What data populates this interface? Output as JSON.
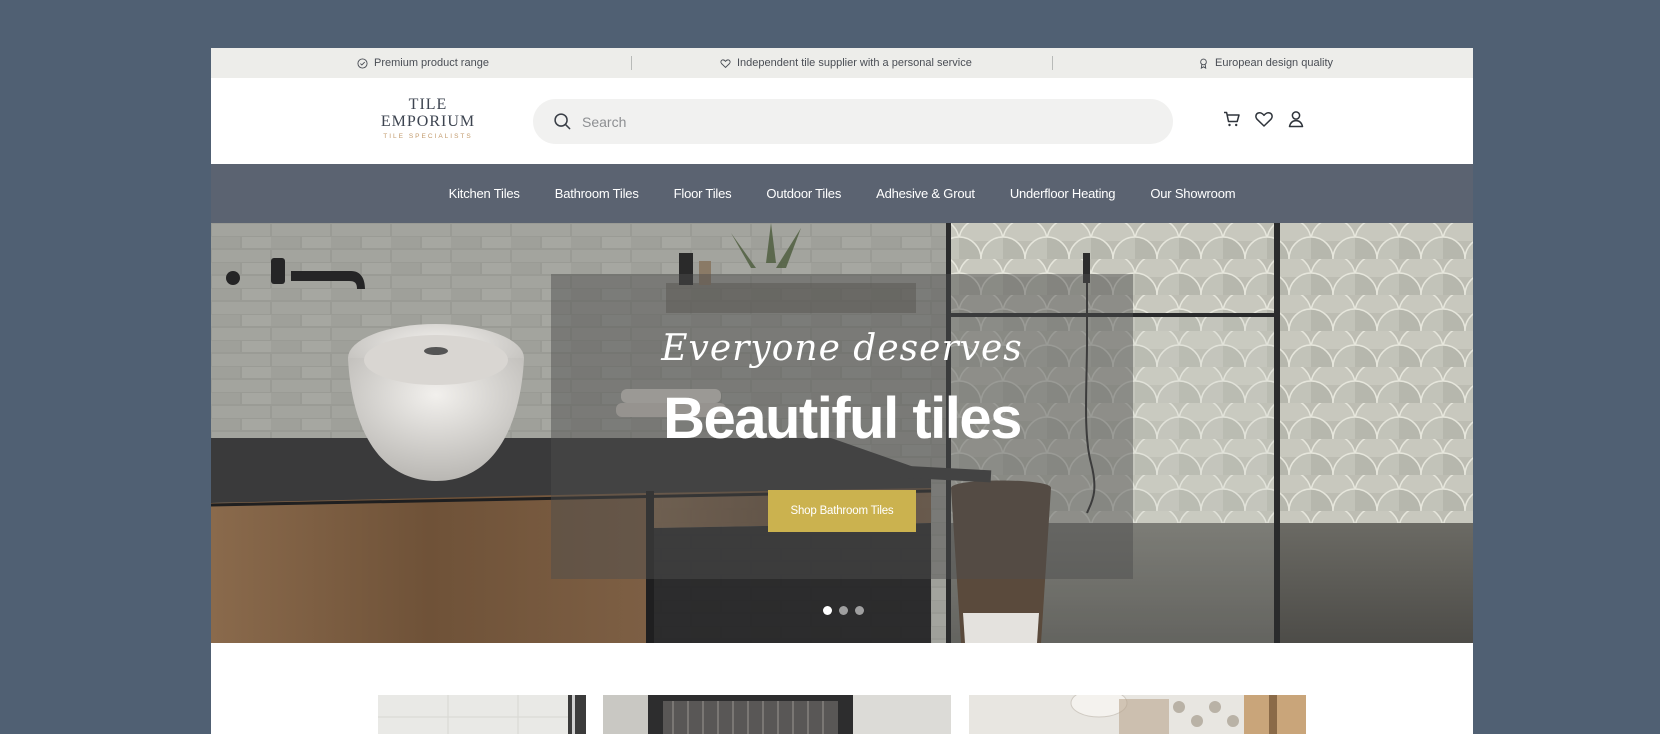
{
  "topbar": {
    "usps": [
      {
        "icon": "check-circle-icon",
        "text": "Premium product range"
      },
      {
        "icon": "heart-icon",
        "text": "Independent tile supplier with a personal service"
      },
      {
        "icon": "award-ribbon-icon",
        "text": "European design quality"
      }
    ]
  },
  "header": {
    "logo": {
      "line1": "TILE",
      "line2": "EMPORIUM",
      "tagline": "TILE SPECIALISTS"
    },
    "search": {
      "placeholder": "Search",
      "value": ""
    },
    "icons": [
      "cart-icon",
      "heart-icon",
      "user-icon"
    ]
  },
  "nav": {
    "items": [
      "Kitchen Tiles",
      "Bathroom Tiles",
      "Floor Tiles",
      "Outdoor Tiles",
      "Adhesive & Grout",
      "Underfloor Heating",
      "Our Showroom"
    ]
  },
  "hero": {
    "script_text": "Everyone deserves",
    "title": "Beautiful tiles",
    "button_label": "Shop Bathroom Tiles",
    "slides": 3,
    "active_slide": 1
  },
  "colors": {
    "page_bg": "#506073",
    "topbar_bg": "#ededea",
    "nav_bg": "#5b6371",
    "button": "#cbb24f",
    "logo_accent": "#c29a6b"
  }
}
